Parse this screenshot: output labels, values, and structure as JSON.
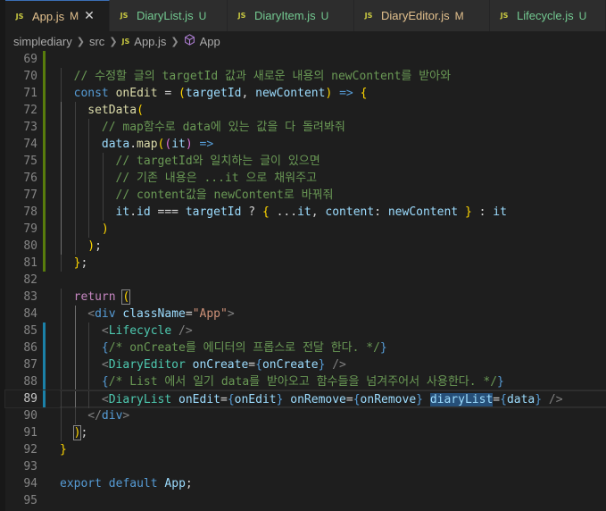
{
  "tabs": [
    {
      "label": "App.js",
      "status": "M",
      "status_color": "#e2c08d",
      "label_color": "#e2c08d",
      "active": true,
      "closable": true
    },
    {
      "label": "DiaryList.js",
      "status": "U",
      "status_color": "#73c991",
      "label_color": "#73c991"
    },
    {
      "label": "DiaryItem.js",
      "status": "U",
      "status_color": "#73c991",
      "label_color": "#73c991"
    },
    {
      "label": "DiaryEditor.js",
      "status": "M",
      "status_color": "#e2c08d",
      "label_color": "#e2c08d"
    },
    {
      "label": "Lifecycle.js",
      "status": "U",
      "status_color": "#73c991",
      "label_color": "#73c991"
    }
  ],
  "js_icon_text": "JS",
  "breadcrumb": {
    "root": "simplediary",
    "folder": "src",
    "file": "App.js",
    "symbol": "App"
  },
  "current_line": 89,
  "lines": [
    {
      "n": "69",
      "git": "add",
      "text": ""
    },
    {
      "n": "70",
      "git": "add",
      "text": "// 수정할 글의 targetId 값과 새로운 내용의 newContent를 받아와"
    },
    {
      "n": "71",
      "git": "add",
      "text": "const onEdit = (targetId, newContent) => {"
    },
    {
      "n": "72",
      "git": "add",
      "text": "setData("
    },
    {
      "n": "73",
      "git": "add",
      "text": "// map함수로 data에 있는 값을 다 돌려봐줘"
    },
    {
      "n": "74",
      "git": "add",
      "text": "data.map((it) =>"
    },
    {
      "n": "75",
      "git": "add",
      "text": "// targetId와 일치하는 글이 있으면"
    },
    {
      "n": "76",
      "git": "add",
      "text": "// 기존 내용은 ...it 으로 채워주고"
    },
    {
      "n": "77",
      "git": "add",
      "text": "// content값을 newContent로 바꿔줘"
    },
    {
      "n": "78",
      "git": "add",
      "text": "it.id === targetId ? { ...it, content: newContent } : it"
    },
    {
      "n": "79",
      "git": "add",
      "text": ")"
    },
    {
      "n": "80",
      "git": "add",
      "text": ");"
    },
    {
      "n": "81",
      "git": "add",
      "text": "};"
    },
    {
      "n": "82",
      "git": "",
      "text": ""
    },
    {
      "n": "83",
      "git": "",
      "text": "return ("
    },
    {
      "n": "84",
      "git": "",
      "text": "<div className=\"App\">"
    },
    {
      "n": "85",
      "git": "mod",
      "text": "<Lifecycle />"
    },
    {
      "n": "86",
      "git": "mod",
      "text": "{/* onCreate를 에디터의 프롭스로 전달 한다. */}"
    },
    {
      "n": "87",
      "git": "mod",
      "text": "<DiaryEditor onCreate={onCreate} />"
    },
    {
      "n": "88",
      "git": "mod",
      "text": "{/* List 에서 일기 data를 받아오고 함수들을 넘겨주어서 사용한다. */}"
    },
    {
      "n": "89",
      "git": "mod",
      "text": "<DiaryList onEdit={onEdit} onRemove={onRemove} diaryList={data} />"
    },
    {
      "n": "90",
      "git": "",
      "text": "</div>"
    },
    {
      "n": "91",
      "git": "",
      "text": ");"
    },
    {
      "n": "92",
      "git": "",
      "text": "}"
    },
    {
      "n": "93",
      "git": "",
      "text": ""
    },
    {
      "n": "94",
      "git": "",
      "text": "export default App;"
    },
    {
      "n": "95",
      "git": "",
      "text": ""
    }
  ]
}
